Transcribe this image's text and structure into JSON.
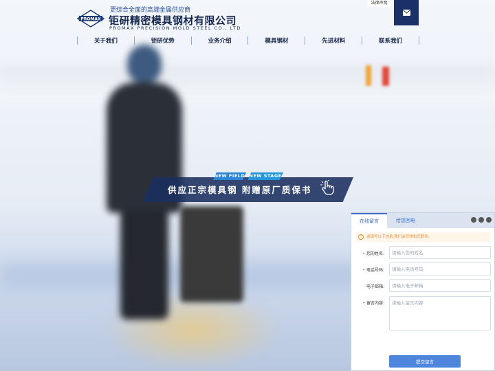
{
  "header": {
    "logo_text": "PROMAX",
    "slogan": "更综合全面的高端金属供应商",
    "company_name": "钜研精密模具钢材有限公司",
    "company_name_en": "PROMAX PRECISION MOLD STEEL CO., LTD",
    "legal_link": "法律声明",
    "mail_icon": "envelope-icon"
  },
  "nav": {
    "items": [
      "关于我们",
      "钜研优势",
      "业务介绍",
      "模具钢材",
      "先进材料",
      "联系我们"
    ]
  },
  "banner": {
    "tag_1": "NEW FIELD",
    "tag_2": "NEW STAGE",
    "title": "供应正宗模具钢 附赠原厂质保书",
    "icon": "pointer-hand-icon"
  },
  "chat": {
    "tabs": [
      "在线留言",
      "给您回电"
    ],
    "notice": "请填写以下信息,我们会尽快和您联系。",
    "fields": [
      {
        "label": "您的姓名:",
        "placeholder": "请输入您的姓名",
        "required": true
      },
      {
        "label": "电话号码:",
        "placeholder": "请输入电话号码",
        "required": true
      },
      {
        "label": "电子邮箱:",
        "placeholder": "请输入电子邮箱",
        "required": false
      },
      {
        "label": "留言内容:",
        "placeholder": "请输入留言内容",
        "required": true
      }
    ],
    "submit": "提交留言"
  },
  "colors": {
    "brand_navy": "#1a3067",
    "accent_blue": "#4d86dc",
    "tag_blue": "#2b86d6"
  }
}
